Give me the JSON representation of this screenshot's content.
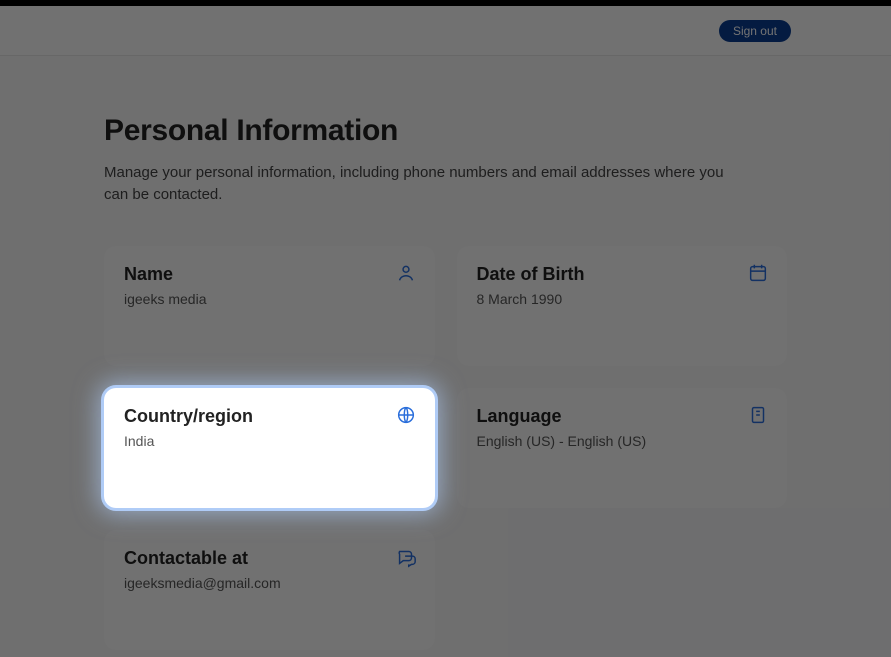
{
  "header": {
    "signout_label": "Sign out"
  },
  "page": {
    "title": "Personal Information",
    "subtitle": "Manage your personal information, including phone numbers and email addresses where you can be contacted."
  },
  "cards": {
    "name": {
      "title": "Name",
      "value": "igeeks media",
      "icon": "person-icon"
    },
    "dob": {
      "title": "Date of Birth",
      "value": "8 March 1990",
      "icon": "calendar-icon"
    },
    "country": {
      "title": "Country/region",
      "value": "India",
      "icon": "globe-icon",
      "highlighted": true
    },
    "language": {
      "title": "Language",
      "value": "English (US) - English (US)",
      "icon": "book-icon"
    },
    "contactable": {
      "title": "Contactable at",
      "value": "igeeksmedia@gmail.com",
      "icon": "chat-icon"
    }
  }
}
